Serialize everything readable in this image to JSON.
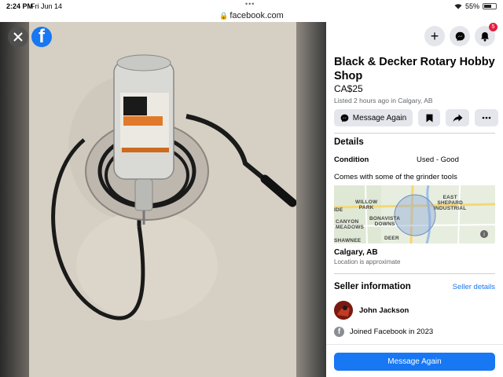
{
  "status_bar": {
    "time": "2:24 PM",
    "date": "Fri Jun 14",
    "url": "facebook.com",
    "battery": "55%"
  },
  "viewer": {
    "close_icon": "close-icon",
    "logo_icon": "facebook-logo",
    "logo_text": "f"
  },
  "header": {
    "notifications_count": "5"
  },
  "listing": {
    "title": "Black & Decker Rotary Hobby Shop",
    "price": "CA$25",
    "listed": "Listed 2 hours ago in Calgary, AB",
    "message_again_label": "Message Again"
  },
  "details": {
    "heading": "Details",
    "condition_label": "Condition",
    "condition_value": "Used - Good",
    "description": "Comes with some of the grinder tools",
    "map_labels": {
      "east_shepard": "EAST\nSHEPARD\nINDUSTRIAL",
      "willow_park": "WILLOW\nPARK",
      "canyon_meadows": "CANYON\nMEADOWS",
      "bonavista": "BONAVISTA\nDOWNS",
      "ide": "IDE",
      "shawnee": "SHAWNEE",
      "deer": "DEER"
    },
    "location": "Calgary, AB",
    "location_note": "Location is approximate"
  },
  "seller": {
    "heading": "Seller information",
    "details_link": "Seller details",
    "name": "John Jackson",
    "joined": "Joined Facebook in 2023"
  },
  "footer": {
    "primary_label": "Message Again"
  },
  "colors": {
    "brand": "#1877f2",
    "badge": "#e41e3f",
    "button_bg": "#e4e6eb"
  }
}
